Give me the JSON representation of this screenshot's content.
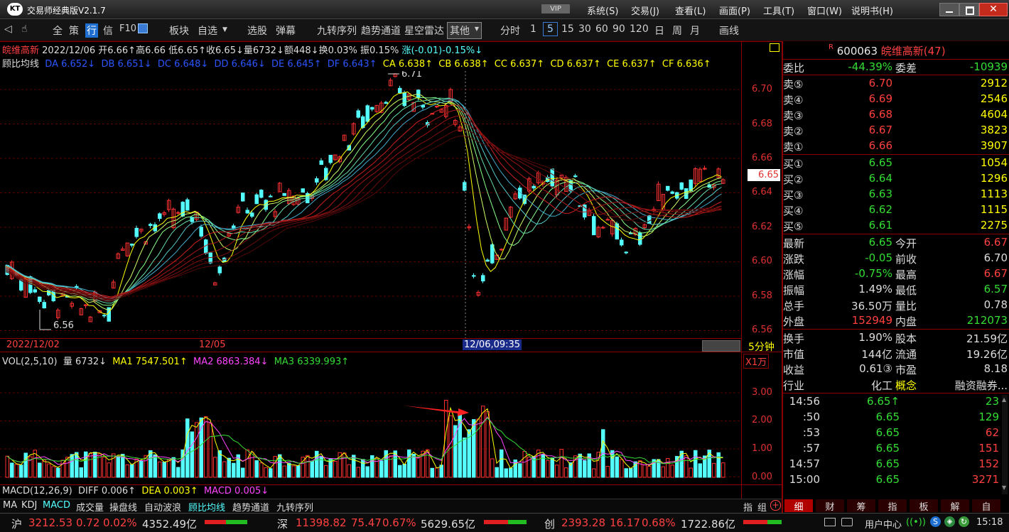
{
  "window": {
    "logo_text": "KT",
    "title": "交易师经典版V2.1.7",
    "vip_badge": "VIP",
    "menu": [
      "系统(S)",
      "交易(J)",
      "查看(L)",
      "画面(P)",
      "工具(T)",
      "窗口(W)",
      "说明书(H)"
    ],
    "controls": [
      "minimize-icon",
      "maximize-icon",
      "close-icon"
    ]
  },
  "toolbar": {
    "items": [
      "全",
      "策",
      "行",
      "信",
      "F10",
      "板块",
      "自选",
      "选股",
      "弹幕",
      "九转序列",
      "趋势通道",
      "星空雷达"
    ],
    "other_dropdown": "其他",
    "periods": [
      "分时",
      "1",
      "5",
      "15",
      "30",
      "60",
      "90",
      "120",
      "日",
      "周",
      "月"
    ],
    "active_period": "5",
    "draw_label": "画线"
  },
  "chart_header": {
    "name": "皖维高新",
    "date": "2022/12/06",
    "open": "开6.66↑",
    "high": "高6.66",
    "low": "低6.65↑",
    "close": "收6.65↓",
    "volume": "量6732↓",
    "amount": "额448↓",
    "turnover": "换0.03%",
    "amplitude": "振0.15%",
    "change": "涨(-0.01)-0.15%↓"
  },
  "gubi": {
    "label": "顾比均线",
    "short": [
      "DA 6.652↓",
      "DB 6.651↓",
      "DC 6.648↓",
      "DD 6.646↓",
      "DE 6.645↑",
      "DF 6.643↑"
    ],
    "long": [
      "CA 6.638↑",
      "CB 6.638↑",
      "CC 6.637↑",
      "CD 6.637↑",
      "CE 6.637↑",
      "CF 6.636↑"
    ]
  },
  "price_axis": [
    "6.70",
    "6.68",
    "6.66",
    "6.64",
    "6.62",
    "6.60",
    "6.58",
    "6.56"
  ],
  "current_price_tag": "6.65",
  "annotations": {
    "high": "6.71",
    "low": "6.56"
  },
  "time_axis": {
    "left": "2022/12/02",
    "mid": "12/05",
    "cursor": "12/06,09:35",
    "period": "5分钟"
  },
  "vol_header": {
    "label": "VOL(2,5,10)",
    "vol": "量 6732↓",
    "ma1": "MA1 7547.501↑",
    "ma2": "MA2 6863.384↓",
    "ma3": "MA3 6339.993↑",
    "unit": "X1万"
  },
  "vol_axis": [
    "3.00",
    "2.00",
    "1.00",
    "0.00"
  ],
  "macd_header": {
    "label": "MACD(12,26,9)",
    "diff": "DIFF 0.006↑",
    "dea": "DEA 0.003↑",
    "macd": "MACD 0.005↓"
  },
  "bottom_tabs": [
    "MA",
    "KDJ",
    "MACD",
    "成交量",
    "操盘线",
    "自动波浪",
    "顾比均线",
    "趋势通道",
    "九转序列"
  ],
  "bottom_tabs_right": [
    "指",
    "组"
  ],
  "right_panel": {
    "code": "600063",
    "name": "皖维高新(47)",
    "weibi_label": "委比",
    "weibi": "-44.39%",
    "weicha_label": "委差",
    "weicha": "-10939",
    "asks": [
      {
        "label": "卖⑤",
        "price": "6.70",
        "vol": "2912"
      },
      {
        "label": "卖④",
        "price": "6.69",
        "vol": "2546"
      },
      {
        "label": "卖③",
        "price": "6.68",
        "vol": "4604"
      },
      {
        "label": "卖②",
        "price": "6.67",
        "vol": "3823"
      },
      {
        "label": "卖①",
        "price": "6.66",
        "vol": "3907"
      }
    ],
    "bids": [
      {
        "label": "买①",
        "price": "6.65",
        "vol": "1054"
      },
      {
        "label": "买②",
        "price": "6.64",
        "vol": "1296"
      },
      {
        "label": "买③",
        "price": "6.63",
        "vol": "1113"
      },
      {
        "label": "买④",
        "price": "6.62",
        "vol": "1115"
      },
      {
        "label": "买⑤",
        "price": "6.61",
        "vol": "2275"
      }
    ],
    "stats": [
      {
        "l1": "最新",
        "v1": "6.65",
        "c1": "#33dd33",
        "l2": "今开",
        "v2": "6.67",
        "c2": "#ff4040"
      },
      {
        "l1": "涨跌",
        "v1": "-0.05",
        "c1": "#33dd33",
        "l2": "前收",
        "v2": "6.70",
        "c2": "#dddddd"
      },
      {
        "l1": "涨幅",
        "v1": "-0.75%",
        "c1": "#33dd33",
        "l2": "最高",
        "v2": "6.67",
        "c2": "#ff4040"
      },
      {
        "l1": "振幅",
        "v1": "1.49%",
        "c1": "#dddddd",
        "l2": "最低",
        "v2": "6.57",
        "c2": "#33dd33"
      },
      {
        "l1": "总手",
        "v1": "36.50万",
        "c1": "#dddddd",
        "l2": "量比",
        "v2": "0.78",
        "c2": "#dddddd"
      },
      {
        "l1": "外盘",
        "v1": "152949",
        "c1": "#ff4040",
        "l2": "内盘",
        "v2": "212073",
        "c2": "#33dd33"
      }
    ],
    "stats2": [
      {
        "l1": "换手",
        "v1": "1.90%",
        "l2": "股本",
        "v2": "21.59亿"
      },
      {
        "l1": "市值",
        "v1": "144亿",
        "l2": "流通",
        "v2": "19.26亿"
      },
      {
        "l1": "收益",
        "v1": "0.61③",
        "l2": "市盈",
        "v2": "8.18"
      },
      {
        "l1": "行业",
        "v1": "化工",
        "l2": "概念",
        "v2": "融资融券..."
      }
    ],
    "ticks": [
      {
        "t": "14:56",
        "p": "6.65↑",
        "v": "23",
        "pc": "#33dd33",
        "vc": "#33dd33"
      },
      {
        "t": ":50",
        "p": "6.65",
        "v": "129",
        "pc": "#33dd33",
        "vc": "#33dd33"
      },
      {
        "t": ":53",
        "p": "6.65",
        "v": "62",
        "pc": "#33dd33",
        "vc": "#ff4040"
      },
      {
        "t": ":57",
        "p": "6.65",
        "v": "151",
        "pc": "#33dd33",
        "vc": "#ff4040"
      },
      {
        "t": "14:57",
        "p": "6.65",
        "v": "152",
        "pc": "#33dd33",
        "vc": "#ff4040"
      },
      {
        "t": "15:00",
        "p": "6.65",
        "v": "3271",
        "pc": "#33dd33",
        "vc": "#ff4040"
      }
    ],
    "tabs": [
      "细",
      "财",
      "筹",
      "指",
      "板",
      "解",
      "自"
    ]
  },
  "status": {
    "sh_label": "沪",
    "sh_index": "3212.53",
    "sh_chg": "0.72",
    "sh_pct": "0.02%",
    "sh_amt": "4352.49亿",
    "sz_label": "深",
    "sz_index": "11398.82",
    "sz_chg": "75.47",
    "sz_pct": "0.67%",
    "sz_amt": "5629.65亿",
    "cy_label": "创",
    "cy_index": "2393.28",
    "cy_chg": "16.17",
    "cy_pct": "0.68%",
    "cy_amt": "1722.86亿",
    "user_center": "用户中心",
    "clock": "15:18"
  },
  "colors": {
    "up": "#ff4040",
    "down": "#54ffff",
    "accent": "#ffff00",
    "grid": "#8b0000"
  }
}
